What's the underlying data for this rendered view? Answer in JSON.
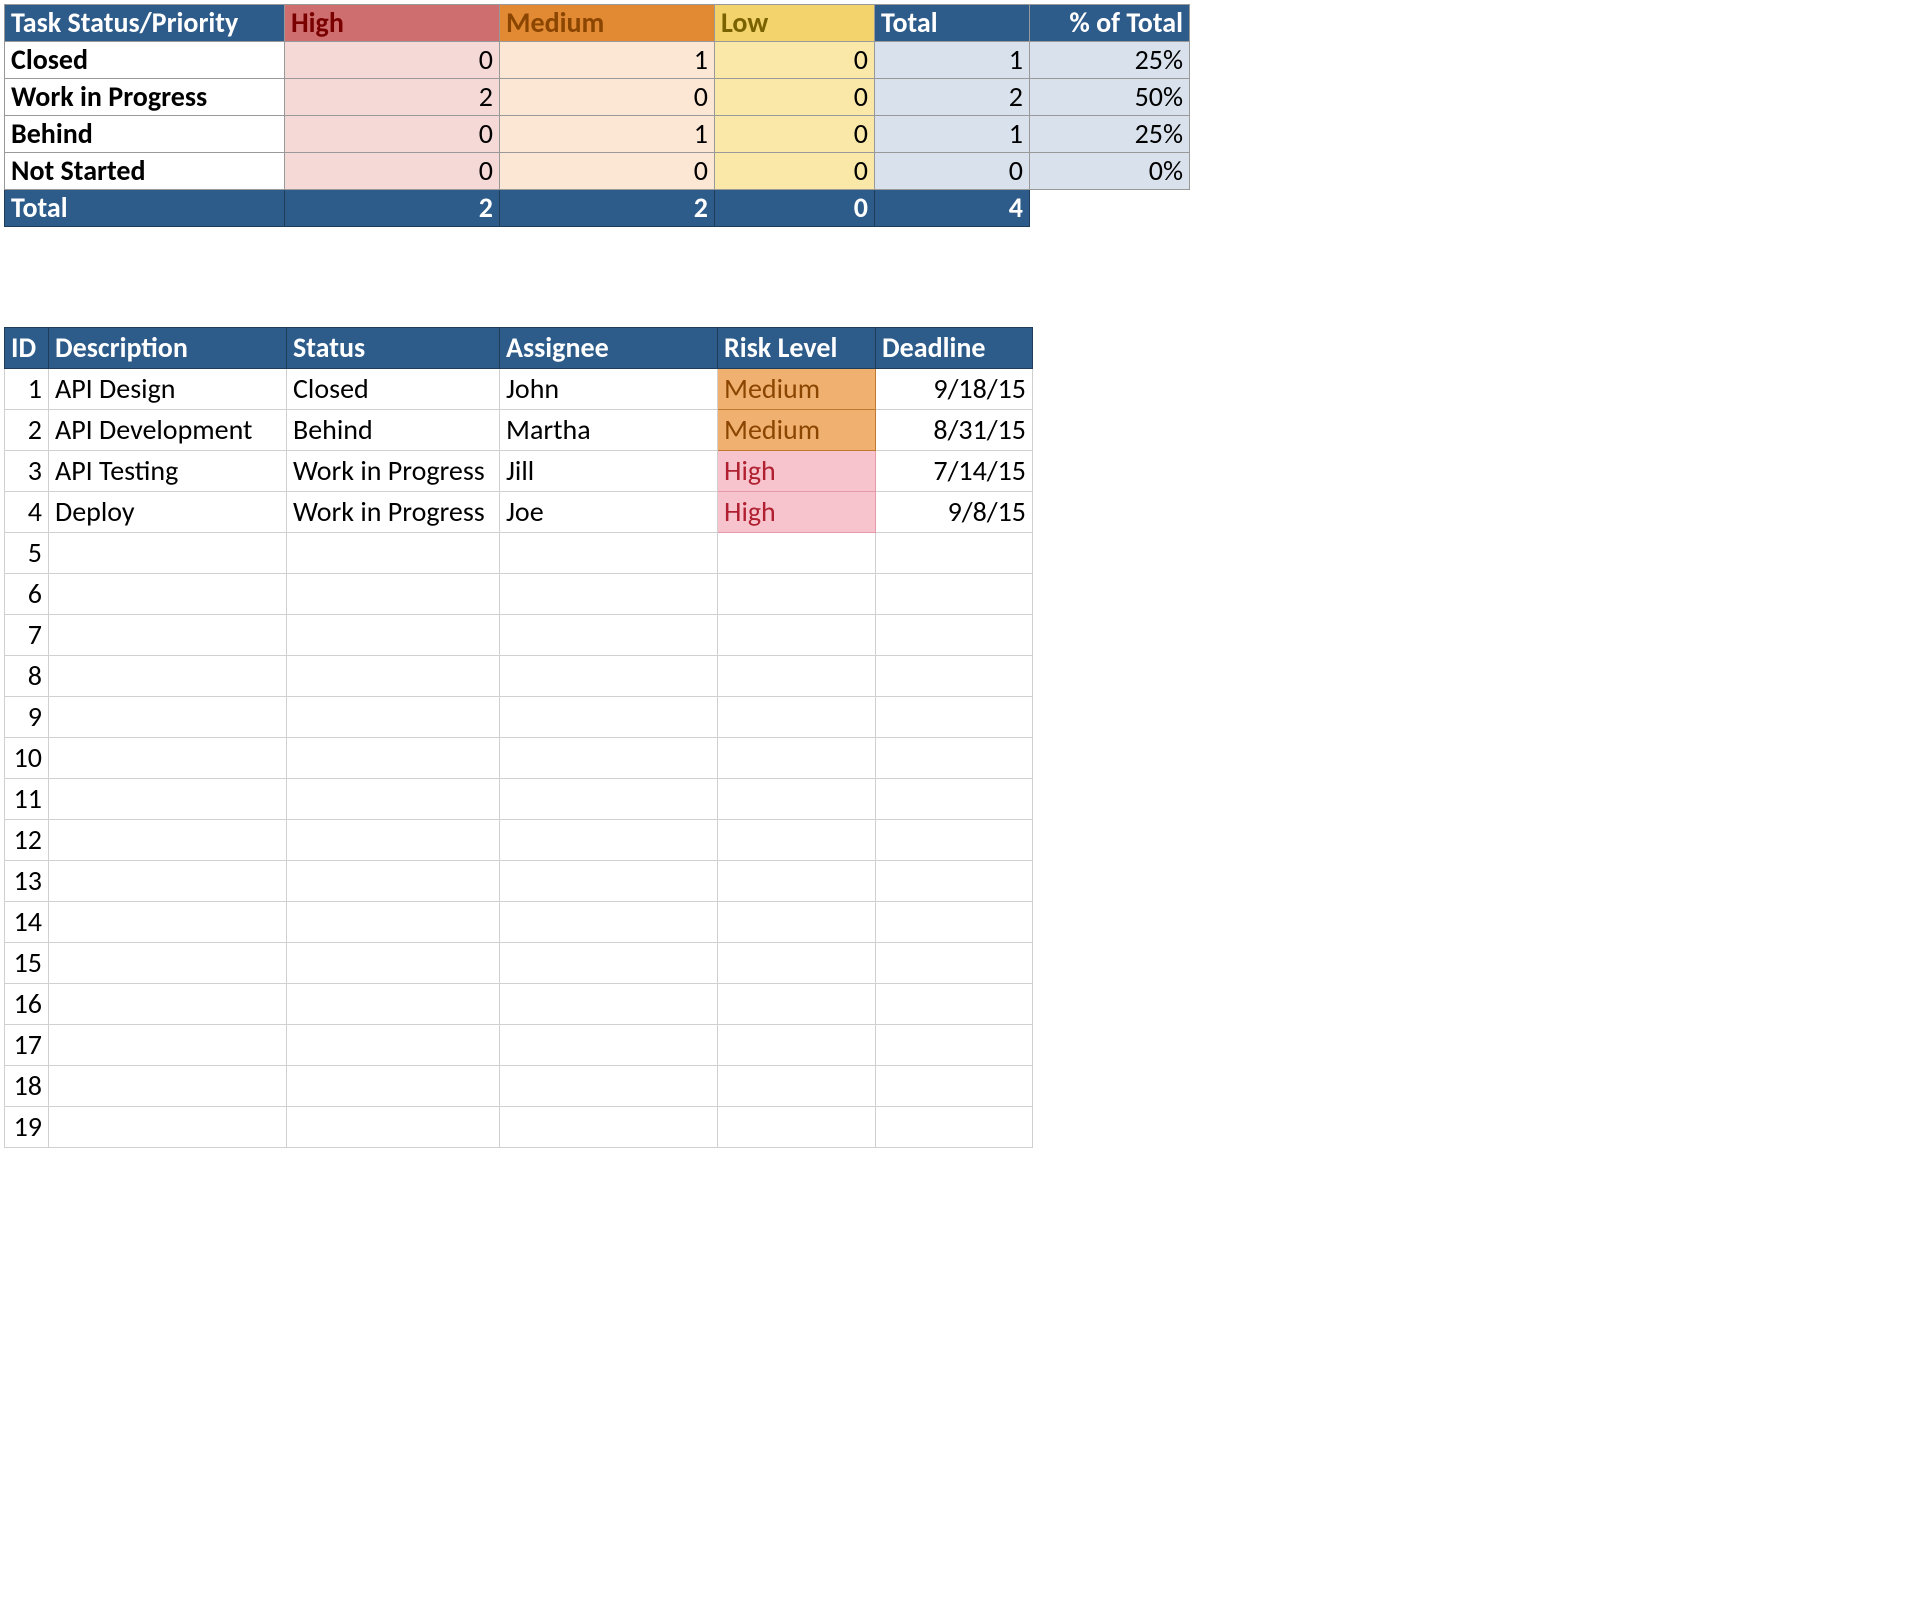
{
  "summary": {
    "headers": {
      "status_priority": "Task Status/Priority",
      "high": "High",
      "medium": "Medium",
      "low": "Low",
      "total": "Total",
      "pct": "% of Total"
    },
    "rows": [
      {
        "label": "Closed",
        "high": "0",
        "med": "1",
        "low": "0",
        "total": "1",
        "pct": "25%"
      },
      {
        "label": "Work in Progress",
        "high": "2",
        "med": "0",
        "low": "0",
        "total": "2",
        "pct": "50%"
      },
      {
        "label": "Behind",
        "high": "0",
        "med": "1",
        "low": "0",
        "total": "1",
        "pct": "25%"
      },
      {
        "label": "Not Started",
        "high": "0",
        "med": "0",
        "low": "0",
        "total": "0",
        "pct": "0%"
      }
    ],
    "totals": {
      "label": "Total",
      "high": "2",
      "med": "2",
      "low": "0",
      "total": "4"
    }
  },
  "detail": {
    "headers": {
      "id": "ID",
      "description": "Description",
      "status": "Status",
      "assignee": "Assignee",
      "risk": "Risk Level",
      "deadline": "Deadline"
    },
    "rows": [
      {
        "id": "1",
        "description": "API Design",
        "status": "Closed",
        "assignee": "John",
        "risk": "Medium",
        "risk_class": "risk-med",
        "deadline": "9/18/15"
      },
      {
        "id": "2",
        "description": "API Development",
        "status": "Behind",
        "assignee": "Martha",
        "risk": "Medium",
        "risk_class": "risk-med",
        "deadline": "8/31/15"
      },
      {
        "id": "3",
        "description": "API Testing",
        "status": "Work in Progress",
        "assignee": "Jill",
        "risk": "High",
        "risk_class": "risk-high",
        "deadline": "7/14/15"
      },
      {
        "id": "4",
        "description": "Deploy",
        "status": "Work in Progress",
        "assignee": "Joe",
        "risk": "High",
        "risk_class": "risk-high",
        "deadline": "9/8/15"
      }
    ],
    "empty_row_count": 15,
    "first_empty_id": 5
  }
}
